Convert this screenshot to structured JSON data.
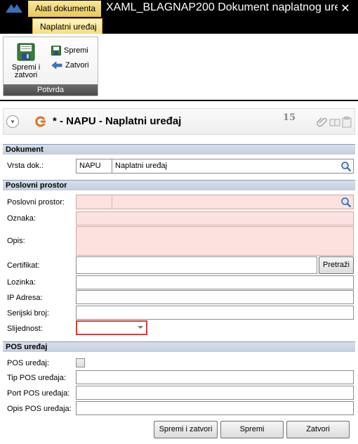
{
  "window": {
    "context_tab": "Alati dokumenta",
    "title": "XAML_BLAGNAP200  Dokument naplatnog uređ…",
    "close_glyph": "✕"
  },
  "ribbon": {
    "tab": "Naplatni uređaj",
    "group_label": "Potvrda",
    "save_close_label": "Spremi i zatvori",
    "save_label": "Spremi",
    "close_label": "Zatvori"
  },
  "doc_header": {
    "title": "* - NAPU - Naplatni uređaj",
    "count": "15"
  },
  "sections": {
    "dokument": "Dokument",
    "poslovni_prostor": "Poslovni prostor",
    "pos": "POS uređaj"
  },
  "fields": {
    "vrsta_dok_label": "Vrsta dok.:",
    "vrsta_dok_code": "NAPU",
    "vrsta_dok_name": "Naplatni uređaj",
    "poslovni_prostor_label": "Poslovni prostor:",
    "oznaka_label": "Oznaka:",
    "opis_label": "Opis:",
    "certifikat_label": "Certifikat:",
    "pretrazi_label": "Pretraži",
    "lozinka_label": "Lozinka:",
    "ip_label": "IP Adresa:",
    "serijski_label": "Serijski broj:",
    "slijednost_label": "Slijednost:",
    "pos_label": "POS uređaj:",
    "tip_pos_label": "Tip POS uređaja:",
    "port_pos_label": "Port POS uređaja:",
    "opis_pos_label": "Opis POS uređaja:"
  },
  "footer": {
    "save_close": "Spremi i zatvori",
    "save": "Spremi",
    "close": "Zatvori"
  }
}
